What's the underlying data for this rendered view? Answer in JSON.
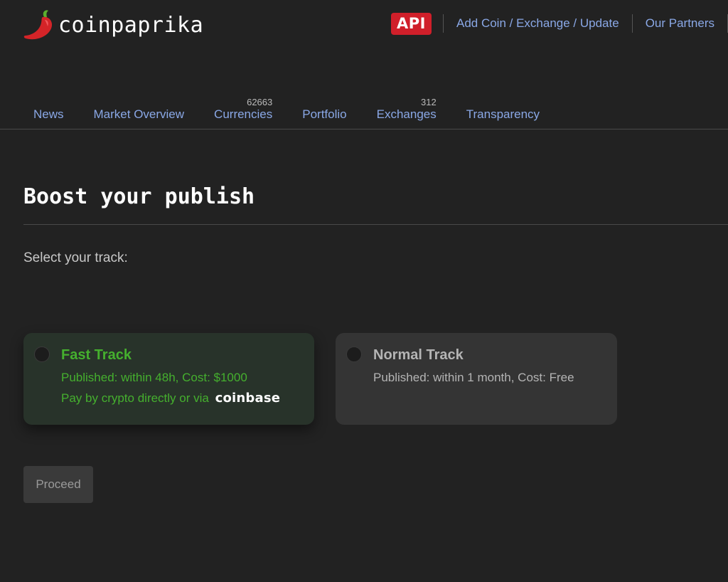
{
  "header": {
    "logo_text": "coinpaprika",
    "api_label": "API",
    "links": [
      "Add Coin / Exchange / Update",
      "Our Partners"
    ]
  },
  "nav": {
    "items": [
      {
        "label": "News",
        "count": ""
      },
      {
        "label": "Market Overview",
        "count": ""
      },
      {
        "label": "Currencies",
        "count": "62663"
      },
      {
        "label": "Portfolio",
        "count": ""
      },
      {
        "label": "Exchanges",
        "count": "312"
      },
      {
        "label": "Transparency",
        "count": ""
      }
    ]
  },
  "main": {
    "title": "Boost your publish",
    "select_label": "Select your track:",
    "tracks": [
      {
        "title": "Fast Track",
        "details": "Published: within 48h, Cost: $1000",
        "payment_prefix": "Pay by crypto directly or via",
        "payment_logo": "coinbase",
        "selected": false
      },
      {
        "title": "Normal Track",
        "details": "Published: within 1 month, Cost: Free",
        "selected": false
      }
    ],
    "proceed_label": "Proceed"
  },
  "colors": {
    "background": "#222222",
    "link": "#8aa8e6",
    "api_badge": "#d01f2a",
    "fast_track_green": "#45b02e",
    "fast_track_bg": "#28332a",
    "normal_track_bg": "#343434"
  },
  "icons": {
    "logo": "chili-pepper-icon",
    "radio": "radio-circle-icon"
  }
}
